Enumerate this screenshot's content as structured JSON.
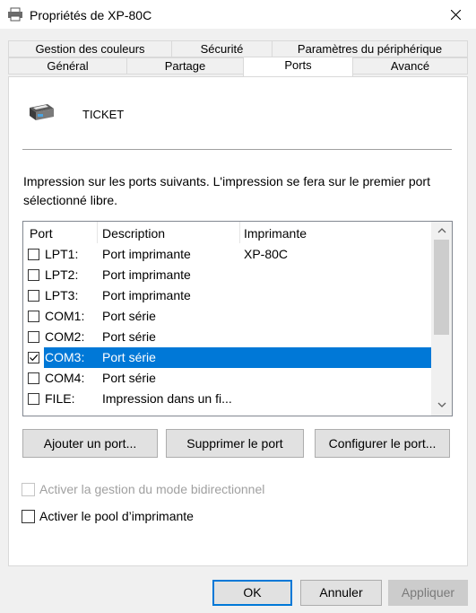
{
  "window": {
    "title": "Propriétés de XP-80C",
    "icon": "printer-icon",
    "close_icon": "close-icon"
  },
  "tabs": {
    "row1": [
      {
        "label": "Gestion des couleurs"
      },
      {
        "label": "Sécurité"
      },
      {
        "label": "Paramètres du périphérique"
      }
    ],
    "row2": [
      {
        "label": "Général"
      },
      {
        "label": "Partage"
      },
      {
        "label": "Ports",
        "active": true
      },
      {
        "label": "Avancé"
      }
    ]
  },
  "printer": {
    "name": "TICKET"
  },
  "description": "Impression sur les ports suivants. L'impression se fera sur le premier port sélectionné libre.",
  "ports_table": {
    "columns": [
      "Port",
      "Description",
      "Imprimante"
    ],
    "rows": [
      {
        "port": "LPT1:",
        "description": "Port imprimante",
        "printer": "XP-80C",
        "checked": false
      },
      {
        "port": "LPT2:",
        "description": "Port imprimante",
        "printer": "",
        "checked": false
      },
      {
        "port": "LPT3:",
        "description": "Port imprimante",
        "printer": "",
        "checked": false
      },
      {
        "port": "COM1:",
        "description": "Port série",
        "printer": "",
        "checked": false
      },
      {
        "port": "COM2:",
        "description": "Port série",
        "printer": "",
        "checked": false
      },
      {
        "port": "COM3:",
        "description": "Port série",
        "printer": "",
        "checked": true,
        "selected": true
      },
      {
        "port": "COM4:",
        "description": "Port série",
        "printer": "",
        "checked": false
      },
      {
        "port": "FILE:",
        "description": "Impression dans un fi...",
        "printer": "",
        "checked": false
      }
    ]
  },
  "actions": {
    "add_port": "Ajouter un port...",
    "delete_port": "Supprimer le port",
    "configure_port": "Configurer le port..."
  },
  "options": {
    "bidirectional": {
      "label": "Activer la gestion du mode bidirectionnel",
      "checked": false,
      "enabled": false
    },
    "pooling": {
      "label": "Activer le pool d’imprimante",
      "checked": false,
      "enabled": true
    }
  },
  "dialog_buttons": {
    "ok": "OK",
    "cancel": "Annuler",
    "apply": "Appliquer"
  },
  "colors": {
    "selection": "#0078d7",
    "accent": "#0078d7"
  }
}
